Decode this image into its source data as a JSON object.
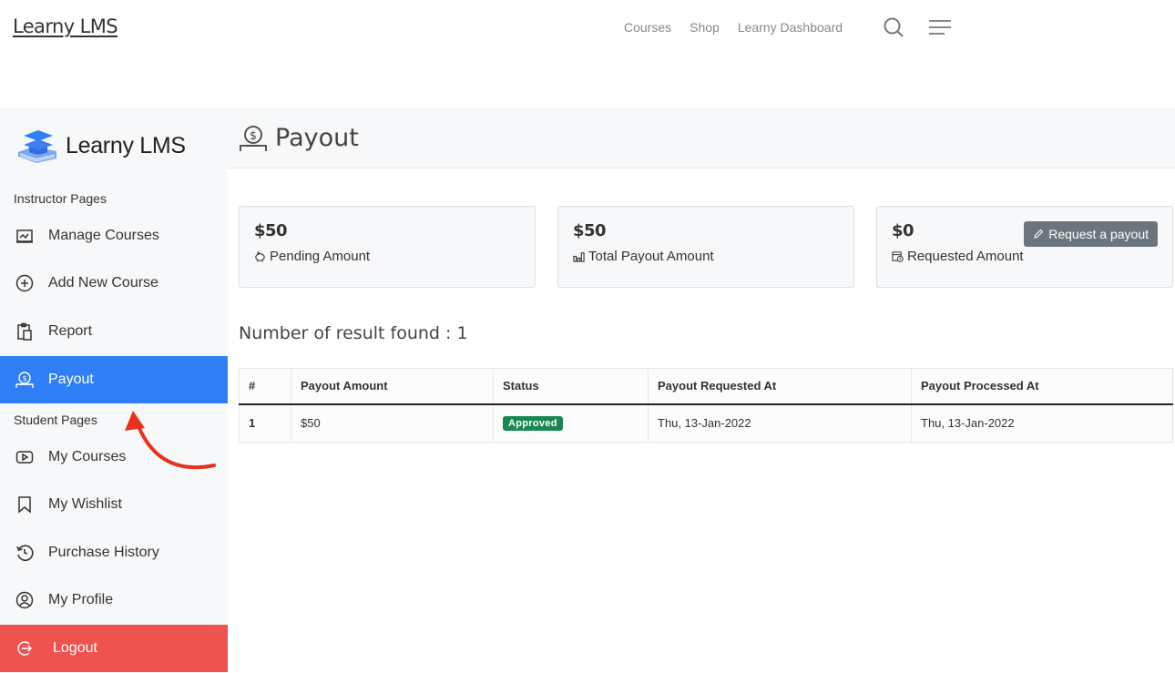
{
  "topbar": {
    "logo": "Learny LMS",
    "nav": [
      "Courses",
      "Shop",
      "Learny Dashboard"
    ],
    "icons": [
      "search-icon",
      "menu-icon"
    ]
  },
  "sidebar": {
    "brand": "Learny LMS",
    "instructor_label": "Instructor Pages",
    "instructor_items": [
      {
        "label": "Manage Courses",
        "icon": "chart-board-icon"
      },
      {
        "label": "Add New Course",
        "icon": "plus-circle-icon"
      },
      {
        "label": "Report",
        "icon": "clipboard-icon"
      },
      {
        "label": "Payout",
        "icon": "payout-icon",
        "active": true
      }
    ],
    "student_label": "Student Pages",
    "student_items": [
      {
        "label": "My Courses",
        "icon": "play-icon"
      },
      {
        "label": "My Wishlist",
        "icon": "bookmark-icon"
      },
      {
        "label": "Purchase History",
        "icon": "history-icon"
      },
      {
        "label": "My Profile",
        "icon": "user-circle-icon"
      }
    ],
    "logout": "Logout"
  },
  "main": {
    "title": "Payout",
    "cards": [
      {
        "amount": "$50",
        "label": "Pending Amount",
        "icon": "piggy-bank-icon"
      },
      {
        "amount": "$50",
        "label": "Total Payout Amount",
        "icon": "bar-chart-icon"
      },
      {
        "amount": "$0",
        "label": "Requested Amount",
        "icon": "calendar-clock-icon"
      }
    ],
    "request_button": "Request a payout",
    "result_count": "Number of result found : 1",
    "table": {
      "headers": [
        "#",
        "Payout Amount",
        "Status",
        "Payout Requested At",
        "Payout Processed At"
      ],
      "rows": [
        {
          "num": "1",
          "amount": "$50",
          "status": "Approved",
          "requested": "Thu, 13-Jan-2022",
          "processed": "Thu, 13-Jan-2022"
        }
      ]
    }
  },
  "colors": {
    "active": "#2f80f7",
    "logout": "#ef5350",
    "approved": "#198754",
    "annotation_arrow": "#e8321e"
  }
}
